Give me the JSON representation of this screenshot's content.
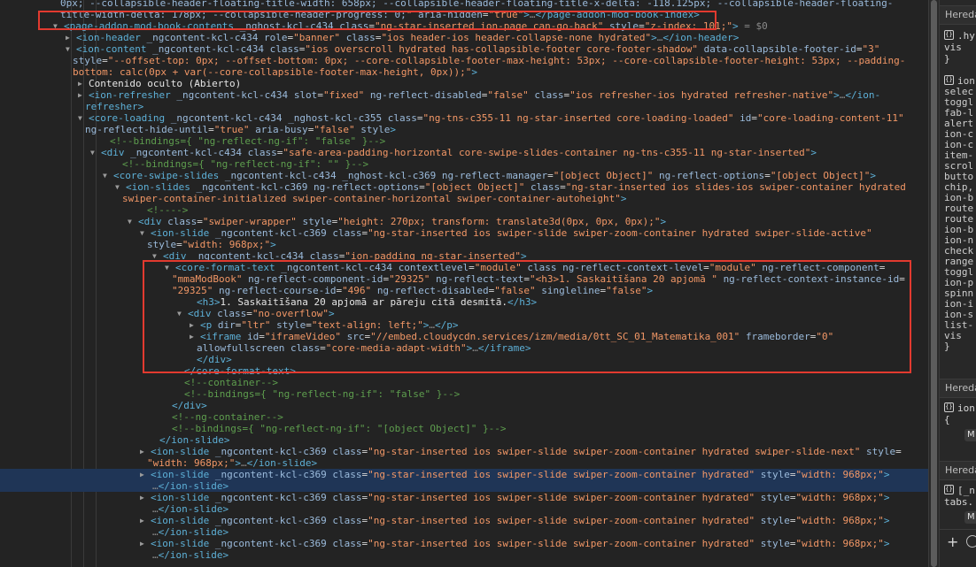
{
  "elements_tree": {
    "lines": [
      {
        "indent": 68,
        "arrow": "",
        "html": "<span class='attr'>0px; --collapsible-header-floating-title-width: 658px; --collapsible-header-floating-title-x-delta: -118.125px; --collapsible-header-floating-</span>"
      },
      {
        "indent": 68,
        "arrow": "",
        "html": "<span class='attr'>title-width-delta: 178px; --collapsible-header-progress: 0;</span><span class='val'>\"</span> <span class='attr'>aria-hidden</span>=<span class='val'>\"true\"</span><span class='tag'>&gt;</span><span class='dim'>…</span><span class='tag'>&lt;/page-addon-mod-book-index&gt;</span>"
      },
      {
        "indent": 72,
        "arrow": "▼",
        "html": "<span class='tag'>&lt;page-addon-mod-book-contents</span> <span class='attr'>_nghost-kcl-c434</span> <span class='attr'>class</span>=<span class='val'>\"ng-star-inserted ion-page can-go-back\"</span> <span class='attr'>style</span>=<span class='val'>\"z-index: 101;\"</span><span class='tag'>&gt;</span> <span class='dim'>= $0</span>"
      },
      {
        "indent": 86,
        "arrow": "▶",
        "html": "<span class='tag'>&lt;ion-header</span> <span class='attr'>_ngcontent-kcl-c434</span> <span class='attr'>role</span>=<span class='val'>\"banner\"</span> <span class='attr'>class</span>=<span class='val'>\"ios header-ios header-collapse-none hydrated\"</span><span class='tag'>&gt;</span><span class='dim'>…</span><span class='tag'>&lt;/ion-header&gt;</span>"
      },
      {
        "indent": 86,
        "arrow": "▼",
        "html": "<span class='tag'>&lt;ion-content</span> <span class='attr'>_ngcontent-kcl-c434</span> <span class='attr'>class</span>=<span class='val'>\"ios overscroll hydrated has-collapsible-footer core-footer-shadow\"</span> <span class='attr'>data-collapsible-footer-id</span>=<span class='val'>\"3\"</span>"
      },
      {
        "indent": 82,
        "arrow": "",
        "html": "<span class='attr'>style</span>=<span class='val'>\"--offset-top: 0px; --offset-bottom: 0px; --core-collapsible-footer-max-height: 53px; --core-collapsible-footer-height: 53px; --padding-</span>"
      },
      {
        "indent": 82,
        "arrow": "",
        "html": "<span class='val'>bottom: calc(0px + var(--core-collapsible-footer-max-height, 0px));\"</span><span class='tag'>&gt;</span>"
      },
      {
        "indent": 100,
        "arrow": "▶",
        "html": "<span class='txt'>Contenido oculto (Abierto)</span>"
      },
      {
        "indent": 100,
        "arrow": "▶",
        "html": "<span class='tag'>&lt;ion-refresher</span> <span class='attr'>_ngcontent-kcl-c434</span> <span class='attr'>slot</span>=<span class='val'>\"fixed\"</span> <span class='attr'>ng-reflect-disabled</span>=<span class='val'>\"false\"</span> <span class='attr'>class</span>=<span class='val'>\"ios refresher-ios hydrated refresher-native\"</span><span class='tag'>&gt;</span><span class='dim'>…</span><span class='tag'>&lt;/ion-</span>"
      },
      {
        "indent": 96,
        "arrow": "",
        "html": "<span class='tag'>refresher&gt;</span>"
      },
      {
        "indent": 100,
        "arrow": "▼",
        "html": "<span class='tag'>&lt;core-loading</span> <span class='attr'>_ngcontent-kcl-c434</span> <span class='attr'>_nghost-kcl-c355</span> <span class='attr'>class</span>=<span class='val'>\"ng-tns-c355-11 ng-star-inserted core-loading-loaded\"</span> <span class='attr'>id</span>=<span class='val'>\"core-loading-content-11\"</span>"
      },
      {
        "indent": 96,
        "arrow": "",
        "html": "<span class='attr'>ng-reflect-hide-until</span>=<span class='val'>\"true\"</span> <span class='attr'>aria-busy</span>=<span class='val'>\"false\"</span> <span class='attr'>style</span><span class='tag'>&gt;</span>"
      },
      {
        "indent": 124,
        "arrow": "",
        "html": "<span class='com'>&lt;!--bindings={ \"ng-reflect-ng-if\": \"false\" }--&gt;</span>"
      },
      {
        "indent": 114,
        "arrow": "▼",
        "html": "<span class='tag'>&lt;div</span> <span class='attr'>_ngcontent-kcl-c434</span> <span class='attr'>class</span>=<span class='val'>\"safe-area-padding-horizontal core-swipe-slides-container ng-tns-c355-11 ng-star-inserted\"</span><span class='tag'>&gt;</span>"
      },
      {
        "indent": 138,
        "arrow": "",
        "html": "<span class='com'>&lt;!--bindings={ \"ng-reflect-ng-if\": \"\" }--&gt;</span>"
      },
      {
        "indent": 128,
        "arrow": "▼",
        "html": "<span class='tag'>&lt;core-swipe-slides</span> <span class='attr'>_ngcontent-kcl-c434</span> <span class='attr'>_nghost-kcl-c369</span> <span class='attr'>ng-reflect-manager</span>=<span class='val'>\"[object Object]\"</span> <span class='attr'>ng-reflect-options</span>=<span class='val'>\"[object Object]\"</span><span class='tag'>&gt;</span>"
      },
      {
        "indent": 142,
        "arrow": "▼",
        "html": "<span class='tag'>&lt;ion-slides</span> <span class='attr'>_ngcontent-kcl-c369</span> <span class='attr'>ng-reflect-options</span>=<span class='val'>\"[object Object]\"</span> <span class='attr'>class</span>=<span class='val'>\"ng-star-inserted ios slides-ios swiper-container hydrated</span>"
      },
      {
        "indent": 138,
        "arrow": "",
        "html": "<span class='val'>swiper-container-initialized swiper-container-horizontal swiper-container-autoheight\"</span><span class='tag'>&gt;</span>"
      },
      {
        "indent": 166,
        "arrow": "",
        "html": "<span class='com'>&lt;!----&gt;</span>"
      },
      {
        "indent": 156,
        "arrow": "▼",
        "html": "<span class='tag'>&lt;div</span> <span class='attr'>class</span>=<span class='val'>\"swiper-wrapper\"</span> <span class='attr'>style</span>=<span class='val'>\"height: 270px; transform: translate3d(0px, 0px, 0px);\"</span><span class='tag'>&gt;</span>"
      },
      {
        "indent": 170,
        "arrow": "▼",
        "html": "<span class='tag'>&lt;ion-slide</span> <span class='attr'>_ngcontent-kcl-c369</span> <span class='attr'>class</span>=<span class='val'>\"ng-star-inserted ios swiper-slide swiper-zoom-container hydrated swiper-slide-active\"</span>"
      },
      {
        "indent": 166,
        "arrow": "",
        "html": "<span class='attr'>style</span>=<span class='val'>\"width: 968px;\"</span><span class='tag'>&gt;</span>"
      },
      {
        "indent": 184,
        "arrow": "▼",
        "html": "<span class='tag'>&lt;div</span> <span class='attr'>_ngcontent-kcl-c434</span> <span class='attr'>class</span>=<span class='val'>\"ion-padding ng-star-inserted\"</span><span class='tag'>&gt;</span>"
      },
      {
        "indent": 198,
        "arrow": "▼",
        "html": "<span class='tag'>&lt;core-format-text</span> <span class='attr'>_ngcontent-kcl-c434</span> <span class='attr'>contextlevel</span>=<span class='val'>\"module\"</span> <span class='attr'>class</span> <span class='attr'>ng-reflect-context-level</span>=<span class='val'>\"module\"</span> <span class='attr'>ng-reflect-component</span>="
      },
      {
        "indent": 194,
        "arrow": "",
        "html": "<span class='val'>\"mmaModBook\"</span> <span class='attr'>ng-reflect-component-id</span>=<span class='val'>\"29325\"</span> <span class='attr'>ng-reflect-text</span>=<span class='val'>\"&lt;h3&gt;1. Saskaitīšana 20 apjomā \"</span> <span class='attr'>ng-reflect-context-instance-id</span>="
      },
      {
        "indent": 194,
        "arrow": "",
        "html": "<span class='val'>\"29325\"</span> <span class='attr'>ng-reflect-course-id</span>=<span class='val'>\"496\"</span> <span class='attr'>ng-reflect-disabled</span>=<span class='val'>\"false\"</span> <span class='attr'>singleline</span>=<span class='val'>\"false\"</span><span class='tag'>&gt;</span>"
      },
      {
        "indent": 222,
        "arrow": "",
        "html": "<span class='tag'>&lt;h3&gt;</span><span class='txt'>1. Saskaitīšana 20 apjomā ar pāreju citā desmitā.</span><span class='tag'>&lt;/h3&gt;</span>"
      },
      {
        "indent": 212,
        "arrow": "▼",
        "html": "<span class='tag'>&lt;div</span> <span class='attr'>class</span>=<span class='val'>\"no-overflow\"</span><span class='tag'>&gt;</span>"
      },
      {
        "indent": 226,
        "arrow": "▶",
        "html": "<span class='tag'>&lt;p</span> <span class='attr'>dir</span>=<span class='val'>\"ltr\"</span> <span class='attr'>style</span>=<span class='val'>\"text-align: left;\"</span><span class='tag'>&gt;</span><span class='dim'>…</span><span class='tag'>&lt;/p&gt;</span>"
      },
      {
        "indent": 226,
        "arrow": "▶",
        "html": "<span class='tag'>&lt;iframe</span> <span class='attr'>id</span>=<span class='val'>\"iframeVideo\"</span> <span class='attr'>src</span>=<span class='val'>\"//embed.cloudycdn.services/izm/media/0tt_SC_01_Matematika_001\"</span> <span class='attr'>frameborder</span>=<span class='val'>\"0\"</span>"
      },
      {
        "indent": 222,
        "arrow": "",
        "html": "<span class='attr'>allowfullscreen</span> <span class='attr'>class</span>=<span class='val'>\"core-media-adapt-width\"</span><span class='tag'>&gt;</span><span class='dim'>…</span><span class='tag'>&lt;/iframe&gt;</span>"
      },
      {
        "indent": 222,
        "arrow": "",
        "html": "<span class='tag'>&lt;/div&gt;</span>"
      },
      {
        "indent": 208,
        "arrow": "",
        "html": "<span class='tag'>&lt;/core-format-text&gt;</span>"
      },
      {
        "indent": 208,
        "arrow": "",
        "html": "<span class='com'>&lt;!--container--&gt;</span>"
      },
      {
        "indent": 208,
        "arrow": "",
        "html": "<span class='com'>&lt;!--bindings={ \"ng-reflect-ng-if\": \"false\" }--&gt;</span>"
      },
      {
        "indent": 194,
        "arrow": "",
        "html": "<span class='tag'>&lt;/div&gt;</span>"
      },
      {
        "indent": 194,
        "arrow": "",
        "html": "<span class='com'>&lt;!--ng-container--&gt;</span>"
      },
      {
        "indent": 194,
        "arrow": "",
        "html": "<span class='com'>&lt;!--bindings={ \"ng-reflect-ng-if\": \"[object Object]\" }--&gt;</span>"
      },
      {
        "indent": 180,
        "arrow": "",
        "html": "<span class='tag'>&lt;/ion-slide&gt;</span>"
      },
      {
        "indent": 170,
        "arrow": "▶",
        "html": "<span class='tag'>&lt;ion-slide</span> <span class='attr'>_ngcontent-kcl-c369</span> <span class='attr'>class</span>=<span class='val'>\"ng-star-inserted ios swiper-slide swiper-zoom-container hydrated swiper-slide-next\"</span> <span class='attr'>style</span>="
      },
      {
        "indent": 166,
        "arrow": "",
        "html": "<span class='val'>\"width: 968px;\"</span><span class='tag'>&gt;</span><span class='dim'>…</span><span class='tag'>&lt;/ion-slide&gt;</span>"
      },
      {
        "indent": 170,
        "arrow": "▶",
        "hl": true,
        "html": "<span class='tag'>&lt;ion-slide</span> <span class='attr'>_ngcontent-kcl-c369</span> <span class='attr'>class</span>=<span class='val'>\"ng-star-inserted ios swiper-slide swiper-zoom-container hydrated\"</span> <span class='attr'>style</span>=<span class='val'>\"width: 968px;\"</span><span class='tag'>&gt;</span>"
      },
      {
        "indent": 172,
        "arrow": "",
        "hl": true,
        "html": "<span class='dim'>…</span><span class='tag'>&lt;/ion-slide&gt;</span>"
      },
      {
        "indent": 170,
        "arrow": "▶",
        "html": "<span class='tag'>&lt;ion-slide</span> <span class='attr'>_ngcontent-kcl-c369</span> <span class='attr'>class</span>=<span class='val'>\"ng-star-inserted ios swiper-slide swiper-zoom-container hydrated\"</span> <span class='attr'>style</span>=<span class='val'>\"width: 968px;\"</span><span class='tag'>&gt;</span>"
      },
      {
        "indent": 172,
        "arrow": "",
        "html": "<span class='dim'>…</span><span class='tag'>&lt;/ion-slide&gt;</span>"
      },
      {
        "indent": 170,
        "arrow": "▶",
        "html": "<span class='tag'>&lt;ion-slide</span> <span class='attr'>_ngcontent-kcl-c369</span> <span class='attr'>class</span>=<span class='val'>\"ng-star-inserted ios swiper-slide swiper-zoom-container hydrated\"</span> <span class='attr'>style</span>=<span class='val'>\"width: 968px;\"</span><span class='tag'>&gt;</span>"
      },
      {
        "indent": 172,
        "arrow": "",
        "html": "<span class='dim'>…</span><span class='tag'>&lt;/ion-slide&gt;</span>"
      },
      {
        "indent": 170,
        "arrow": "▶",
        "html": "<span class='tag'>&lt;ion-slide</span> <span class='attr'>_ngcontent-kcl-c369</span> <span class='attr'>class</span>=<span class='val'>\"ng-star-inserted ios swiper-slide swiper-zoom-container hydrated\"</span> <span class='attr'>style</span>=<span class='val'>\"width: 968px;\"</span><span class='tag'>&gt;</span>"
      },
      {
        "indent": 172,
        "arrow": "",
        "html": "<span class='dim'>…</span><span class='tag'>&lt;/ion-slide&gt;</span>"
      }
    ]
  },
  "styles_panel": {
    "inherited_label": "Heredado",
    "rows_1": [
      ".hy",
      "vis",
      "}"
    ],
    "rows_2": [
      "ion",
      "selec",
      "toggl",
      "fab-l",
      "alert",
      "ion-c",
      "ion-c",
      "item-",
      "scrol",
      "butto",
      "chip,",
      "ion-b",
      "route",
      "route",
      "ion-b",
      "ion-n",
      "check",
      "range",
      "toggl",
      "ion-p",
      "spinn",
      "ion-i",
      "ion-s",
      "list-",
      "vis",
      "}"
    ],
    "rows_3": [
      "ion",
      "{"
    ],
    "rows_4": [
      "[_n",
      "tabs."
    ],
    "badge": "M",
    "icon_glyph": "{}",
    "add_symbol": "+"
  }
}
